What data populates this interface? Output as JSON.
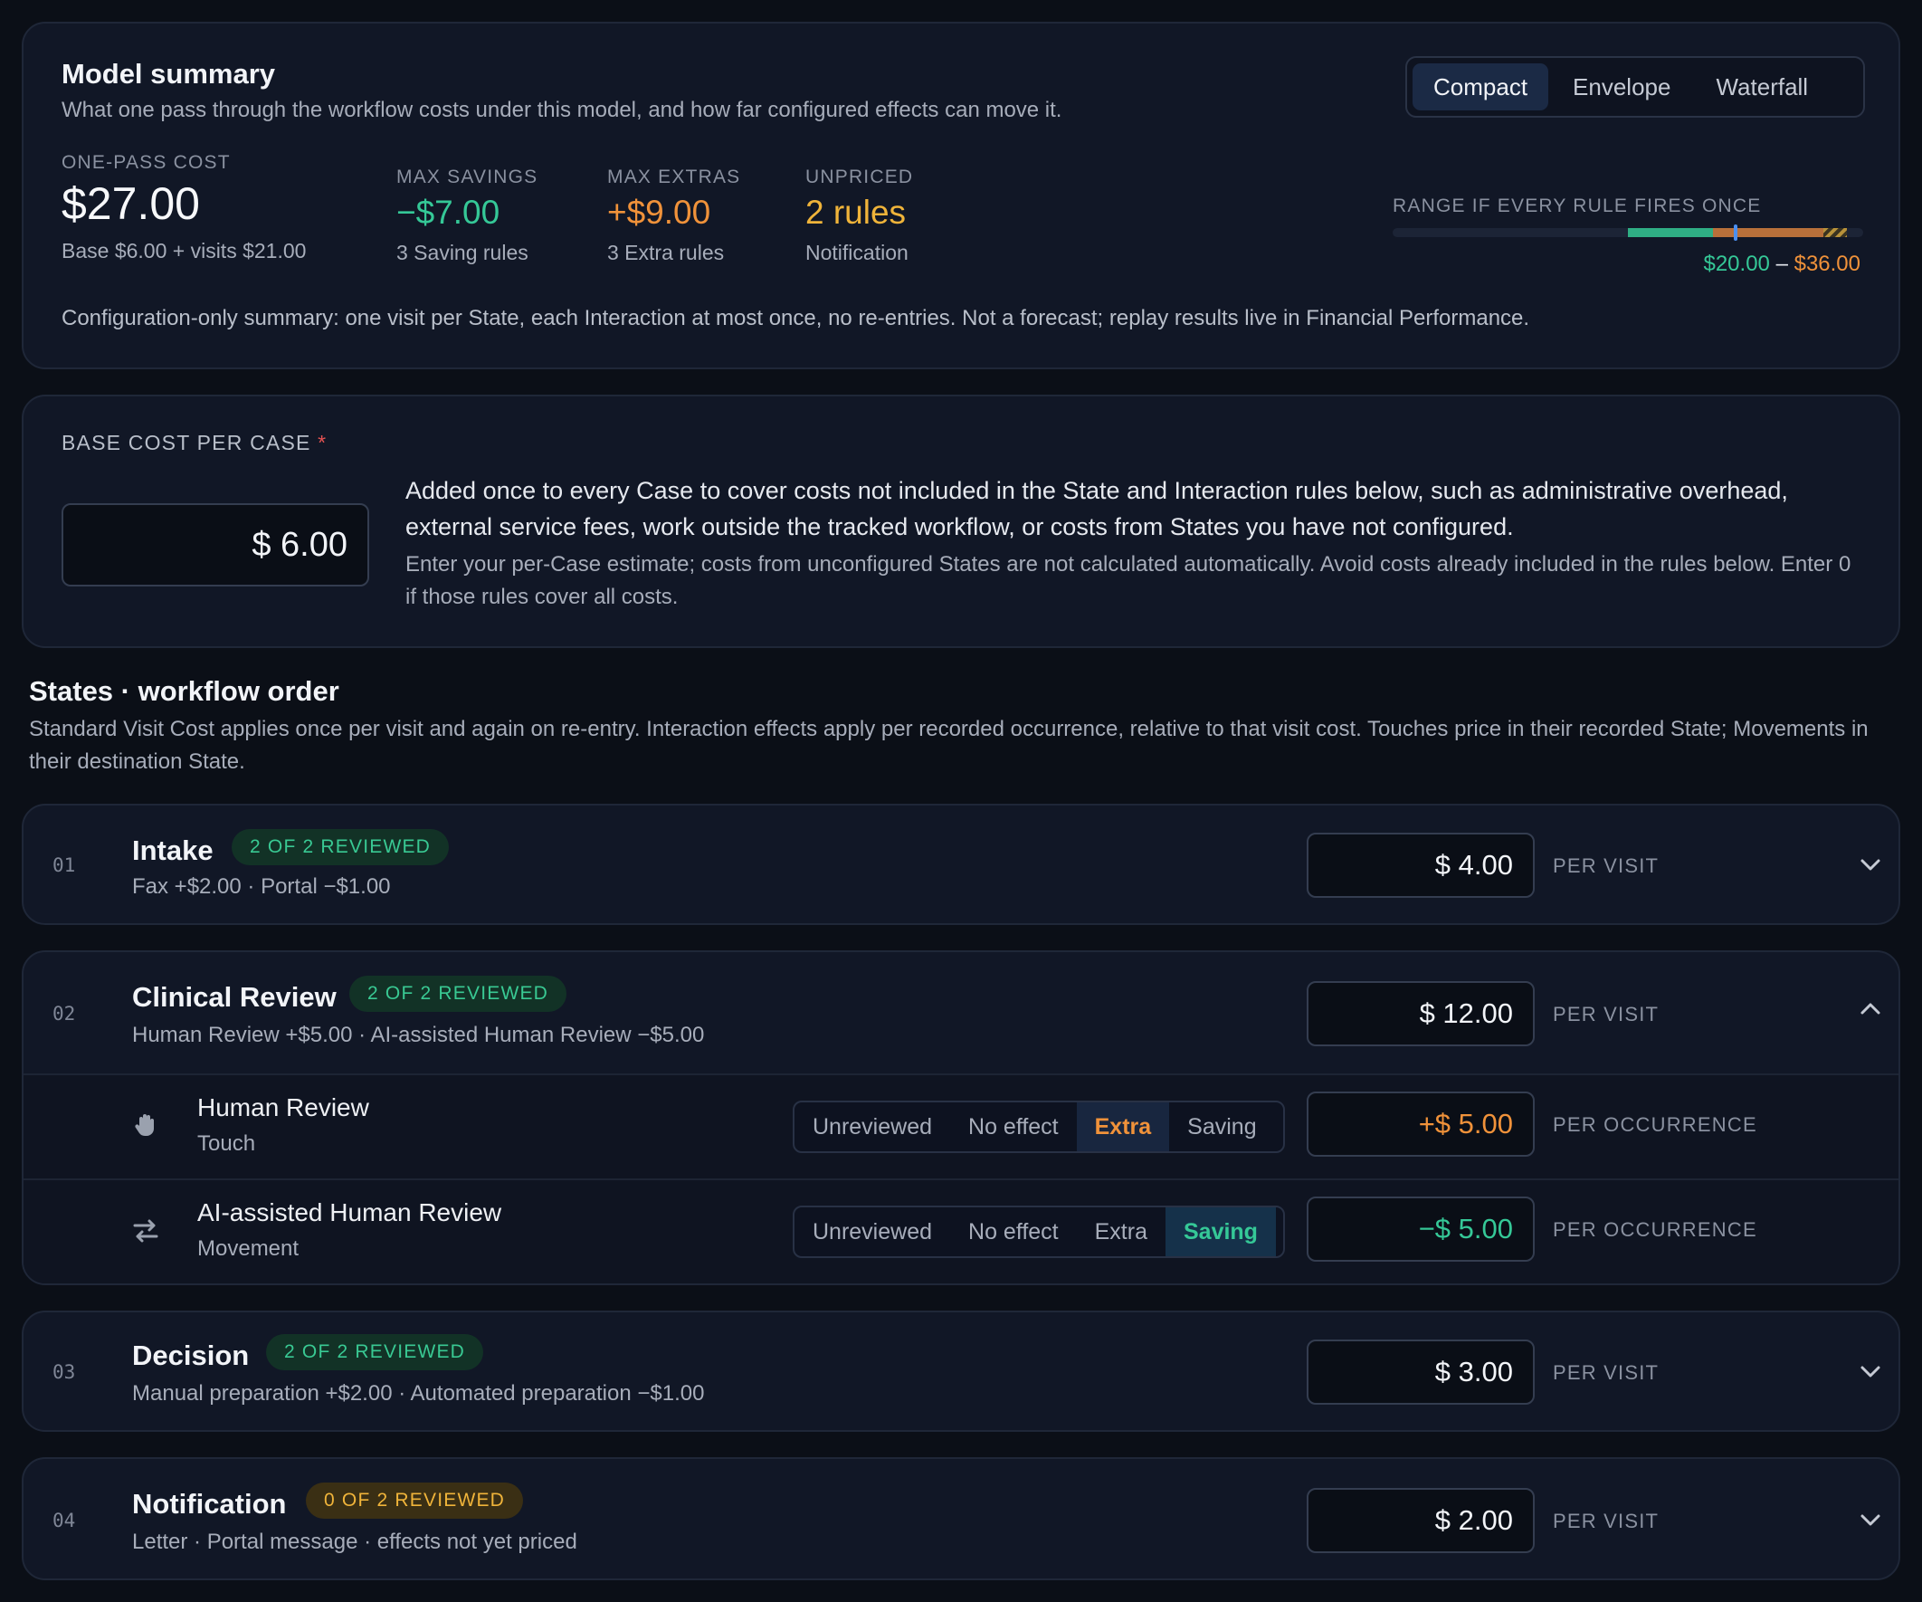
{
  "summary": {
    "title": "Model summary",
    "subtitle": "What one pass through the workflow costs under this model, and how far configured effects can move it.",
    "views": [
      "Compact",
      "Envelope",
      "Waterfall"
    ],
    "active_view": "Compact",
    "one_pass": {
      "label": "ONE-PASS COST",
      "value": "$27.00",
      "sub": "Base $6.00 + visits $21.00"
    },
    "max_savings": {
      "label": "MAX SAVINGS",
      "value": "−$7.00",
      "sub": "3 Saving rules"
    },
    "max_extras": {
      "label": "MAX EXTRAS",
      "value": "+$9.00",
      "sub": "3 Extra rules"
    },
    "unpriced": {
      "label": "UNPRICED",
      "value": "2 rules",
      "sub": "Notification"
    },
    "range": {
      "label": "RANGE IF EVERY RULE FIRES ONCE",
      "low": "$20.00",
      "sep": "–",
      "high": "$36.00",
      "min_value": 20,
      "current_value": 27,
      "max_value": 36
    },
    "footnote": "Configuration-only summary: one visit per State, each Interaction at most once, no re-entries. Not a forecast; replay results live in Financial Performance."
  },
  "base": {
    "label": "BASE COST PER CASE",
    "required_mark": "*",
    "value": "$ 6.00",
    "description": "Added once to every Case to cover costs not included in the State and Interaction rules below, such as administrative overhead, external service fees, work outside the tracked workflow, or costs from States you have not configured.",
    "note": "Enter your per-Case estimate; costs from unconfigured States are not calculated automatically. Avoid costs already included in the rules below. Enter 0 if those rules cover all costs."
  },
  "states_header": {
    "title": "States · workflow order",
    "description": "Standard Visit Cost applies once per visit and again on re-entry. Interaction effects apply per recorded occurrence, relative to that visit cost. Touches price in their recorded State; Movements in their destination State."
  },
  "states": [
    {
      "num": "01",
      "name": "Intake",
      "badge": "2 OF 2 REVIEWED",
      "summary": "Fax +$2.00 · Portal −$1.00",
      "cost": "$ 4.00",
      "unit": "PER VISIT"
    },
    {
      "num": "02",
      "name": "Clinical Review",
      "badge": "2 OF 2 REVIEWED",
      "summary": "Human Review +$5.00 · AI-assisted Human Review −$5.00",
      "cost": "$ 12.00",
      "unit": "PER VISIT",
      "interactions": [
        {
          "name": "Human Review",
          "type": "Touch",
          "icon": "hand-icon",
          "effect": "Extra",
          "amount": "+$ 5.00",
          "unit": "PER OCCURRENCE"
        },
        {
          "name": "AI-assisted Human Review",
          "type": "Movement",
          "icon": "arrows-swap-icon",
          "effect": "Saving",
          "amount": "−$ 5.00",
          "unit": "PER OCCURRENCE"
        }
      ]
    },
    {
      "num": "03",
      "name": "Decision",
      "badge": "2 OF 2 REVIEWED",
      "summary": "Manual preparation +$2.00 · Automated preparation −$1.00",
      "cost": "$ 3.00",
      "unit": "PER VISIT"
    },
    {
      "num": "04",
      "name": "Notification",
      "badge": "0 OF 2 REVIEWED",
      "summary": "Letter · Portal message · effects not yet priced",
      "cost": "$ 2.00",
      "unit": "PER VISIT"
    }
  ],
  "effect_options": [
    "Unreviewed",
    "No effect",
    "Extra",
    "Saving"
  ],
  "colors": {
    "saving": "#35c897",
    "extra": "#f0923a",
    "unpriced": "#f0b43a",
    "accent": "#4b8ff0"
  }
}
